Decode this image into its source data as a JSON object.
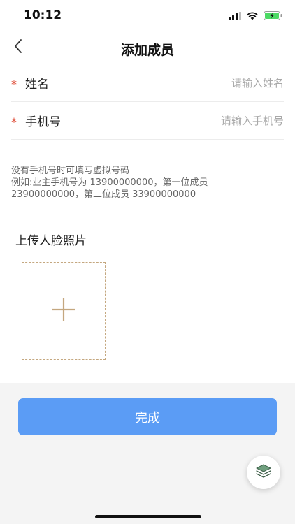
{
  "status_bar": {
    "time": "10:12",
    "colors": {
      "battery": "#4cd964"
    }
  },
  "nav": {
    "title": "添加成员",
    "back_icon": "chevron-left-icon"
  },
  "form": {
    "name": {
      "required_mark": "*",
      "label": "姓名",
      "placeholder": "请输入姓名",
      "value": ""
    },
    "phone": {
      "required_mark": "*",
      "label": "手机号",
      "placeholder": "请输入手机号",
      "value": ""
    }
  },
  "hint": {
    "lines": [
      "没有手机号时可填写虚拟号码",
      "例如:业主手机号为 13900000000，第一位成员",
      "23900000000，第二位成员 33900000000"
    ]
  },
  "upload": {
    "title": "上传人脸照片",
    "icon": "plus-icon"
  },
  "actions": {
    "done_label": "完成"
  },
  "float_button": {
    "icon": "layers-icon"
  },
  "colors": {
    "primary": "#5b9cf5",
    "required": "#e0533f",
    "upload_border": "#c4a77f"
  }
}
